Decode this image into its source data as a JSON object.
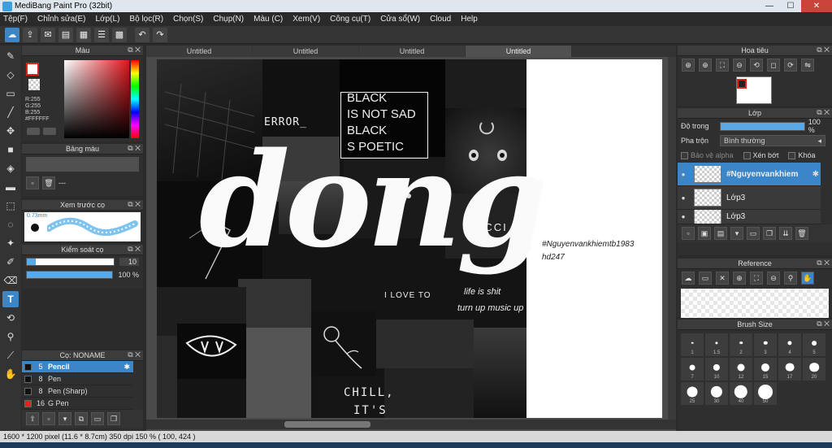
{
  "window": {
    "title": "MediBang Paint Pro (32bit)",
    "minimize": "—",
    "maximize": "☐",
    "close": "✕"
  },
  "menu": [
    "Tệp(F)",
    "Chỉnh sửa(E)",
    "Lớp(L)",
    "Bộ lọc(R)",
    "Chọn(S)",
    "Chụp(N)",
    "Màu (C)",
    "Xem(V)",
    "Công cụ(T)",
    "Cửa sổ(W)",
    "Cloud",
    "Help"
  ],
  "panels": {
    "color": {
      "title": "Màu",
      "r": "R:255",
      "g": "G:255",
      "b": "B:255",
      "hex": "#FFFFFF"
    },
    "palette": {
      "title": "Bảng màu",
      "dash": "---"
    },
    "brush_preview": {
      "title": "Xem trước cọ",
      "size": "0.73mm"
    },
    "brush_control": {
      "title": "Kiểm soát cọ",
      "size_value": "10",
      "opacity_value": "100 %",
      "size_fraction": 0.1,
      "opacity_fraction": 1.0
    },
    "brush_list": {
      "title": "Cọ: NONAME",
      "items": [
        {
          "size": "5",
          "name": "Pencil",
          "selected": true,
          "color": "#111111"
        },
        {
          "size": "8",
          "name": "Pen",
          "selected": false,
          "color": "#111111"
        },
        {
          "size": "8",
          "name": "Pen (Sharp)",
          "selected": false,
          "color": "#111111"
        },
        {
          "size": "16",
          "name": "G Pen",
          "selected": false,
          "color": "#e0231b"
        }
      ]
    },
    "navigator": {
      "title": "Hoa tiêu"
    },
    "layers": {
      "title": "Lớp",
      "opacity_label": "Độ trong",
      "opacity_value": "100 %",
      "blend_label": "Pha trộn",
      "blend_value": "Bình thường",
      "protect_alpha": "Bảo vệ alpha",
      "clipping": "Xén bớt",
      "lock": "Khóa",
      "items": [
        {
          "name": "#Nguyenvankhiem",
          "selected": true
        },
        {
          "name": "Lớp3",
          "selected": false
        },
        {
          "name": "Lớp3",
          "selected": false
        }
      ]
    },
    "reference": {
      "title": "Reference"
    },
    "brush_size": {
      "title": "Brush Size",
      "sizes": [
        "1",
        "1.5",
        "2",
        "3",
        "4",
        "5",
        "7",
        "10",
        "12",
        "15",
        "17",
        "20",
        "25",
        "30",
        "40",
        "50"
      ]
    }
  },
  "canvas": {
    "tabs": [
      "Untitled",
      "Untitled",
      "Untitled",
      "Untitled"
    ],
    "active_tab": 3,
    "texts": {
      "black1": "BLACK",
      "not_sad": "IS NOT SAD",
      "black2": "BLACK",
      "poetic": "S POETIC",
      "error": "ERROR_",
      "big_word": "dong",
      "ucci": "UCCI",
      "love_to": "I LOVE TO",
      "life": "life is shit",
      "music": "turn up music up",
      "chill": "CHILL,",
      "its": "IT'S",
      "signature": "#Nguyenvankhiemtb1983",
      "signature2": "hd247"
    }
  },
  "status": "1600 * 1200 pixel   (11.6 * 8.7cm)   350 dpi   150 %   ( 100, 424 )",
  "colors": {
    "accent": "#3b86c8",
    "fg_border": "#e0231b"
  }
}
